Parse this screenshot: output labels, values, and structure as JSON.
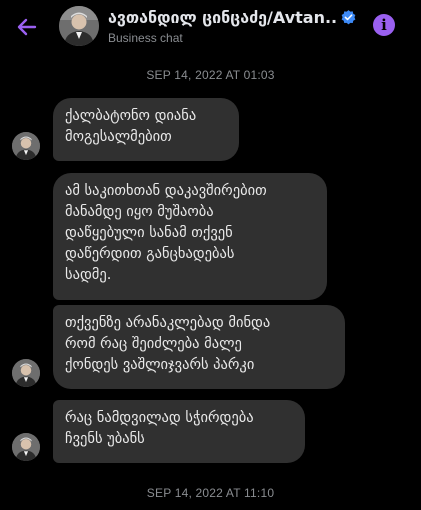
{
  "header": {
    "title": "ავთანდილ ცინცაძე/Avtan...",
    "subtitle": "Business chat",
    "back_icon": "arrow-left-icon",
    "verified_icon": "verified-badge-icon",
    "info_icon": "info-icon",
    "accent_color": "#9a60f0"
  },
  "messages": {
    "timestamp_1": "SEP 14, 2022 AT 01:03",
    "m1": [
      "ქალბატონო დიანა",
      "მოგესალმებით"
    ],
    "m2": [
      "ამ საკითხთან დაკავშირებით",
      "მანამდე იყო მუშაობა",
      "დაწყებული სანამ თქვენ",
      "დაწერდით განცხადებას",
      "სადმე."
    ],
    "m3": [
      "თქვენზე არანაკლებად მინდა",
      "რომ რაც შეიძლება მალე",
      "ქონდეს ვაშლიჯვარს პარკი"
    ],
    "m4": [
      "რაც ნამდვილად სჭირდება",
      "ჩვენს უბანს"
    ],
    "timestamp_2": "SEP 14, 2022 AT 11:10"
  }
}
